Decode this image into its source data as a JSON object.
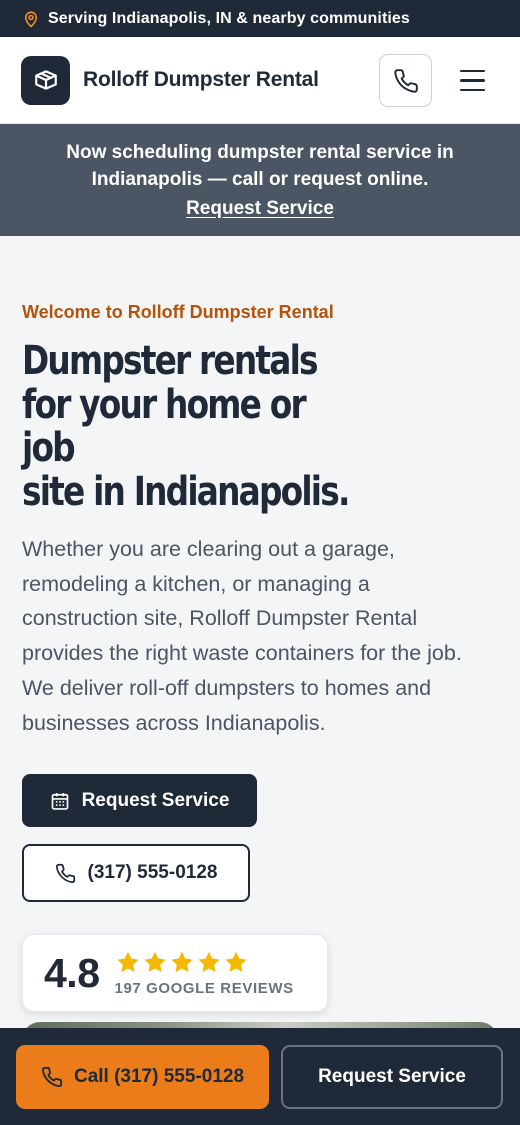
{
  "topbar": {
    "text": "Serving Indianapolis, IN & nearby communities",
    "icon": "map-pin-icon"
  },
  "header": {
    "brand": "Rolloff Dumpster Rental",
    "logo_icon": "box-icon",
    "phone_icon": "phone-icon",
    "menu_icon": "hamburger-menu-icon"
  },
  "banner": {
    "line1": "Now scheduling dumpster rental service in",
    "line2": "Indianapolis — call or request online.",
    "link": "Request Service"
  },
  "hero": {
    "eyebrow": "Welcome to Rolloff Dumpster Rental",
    "headline_1": "Dumpster rentals",
    "headline_2": "for your home or job",
    "headline_3": "site in Indianapolis.",
    "lead_1": "Whether you are clearing out a garage,",
    "lead_2": "remodeling a kitchen, or managing a",
    "lead_3": "construction site, Rolloff Dumpster Rental",
    "lead_4": "provides the right waste containers for the job.",
    "lead_5": "We deliver roll-off dumpsters to homes and",
    "lead_6": "businesses across Indianapolis.",
    "primary_button": "Request Service",
    "phone_button": "(317) 555-0128"
  },
  "rating": {
    "score": "4.8",
    "stars": 5,
    "reviews": "197 GOOGLE REVIEWS"
  },
  "bottom_bar": {
    "call_label": "Call (317) 555-0128",
    "request_label": "Request Service"
  },
  "colors": {
    "primary": "#1f2937",
    "accent": "#ea7d1a",
    "eyebrow": "#b45309",
    "star": "#f5b800"
  }
}
